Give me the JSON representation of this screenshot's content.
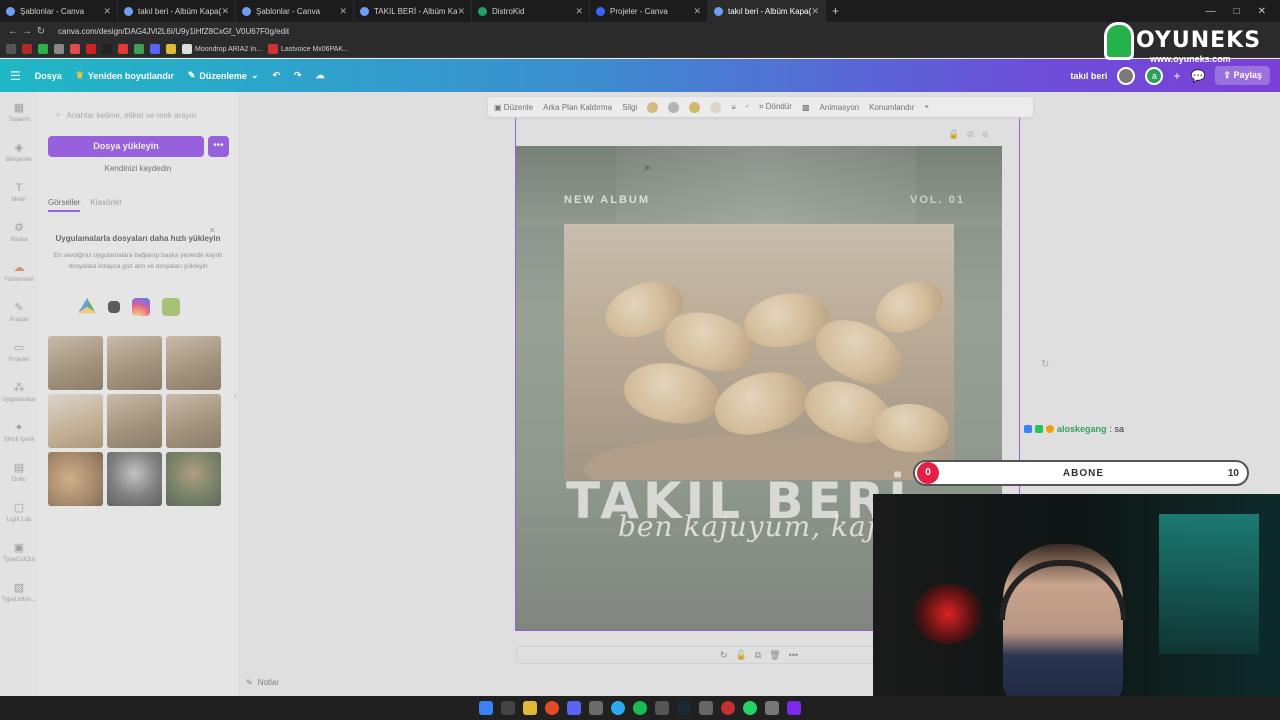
{
  "browser": {
    "tabs": [
      {
        "title": "Şablonlar - Canva",
        "active": false
      },
      {
        "title": "takıl beri - Albüm Kapağı",
        "active": false
      },
      {
        "title": "Şablonlar - Canva",
        "active": false
      },
      {
        "title": "TAKIL BERİ - Albüm Kapağı",
        "active": false
      },
      {
        "title": "DistroKid",
        "active": false
      },
      {
        "title": "Projeler - Canva",
        "active": false
      },
      {
        "title": "takıl beri - Albüm Kapağı",
        "active": true
      }
    ],
    "url": "canva.com/design/DAG4JVi2L6I/U9y1iHfZ8CxGf_V0U67F0g/edit",
    "bookmarks": [
      "Moondrop ARIA2 In...",
      "Lastvoice Mx06PAK..."
    ]
  },
  "canva_top": {
    "file": "Dosya",
    "resize": "Yeniden boyutlandır",
    "edit": "Düzenleme",
    "project_name": "takıl beri",
    "avatar_letter": "a",
    "share": "Paylaş"
  },
  "rail": [
    {
      "icon": "design-icon",
      "label": "Tasarım"
    },
    {
      "icon": "elements-icon",
      "label": "Bileşenler"
    },
    {
      "icon": "text-icon",
      "label": "Metin"
    },
    {
      "icon": "brand-icon",
      "label": "Marka"
    },
    {
      "icon": "uploads-icon",
      "label": "Yüklemeler"
    },
    {
      "icon": "tools-icon",
      "label": "Araçlar"
    },
    {
      "icon": "projects-icon",
      "label": "Projeler"
    },
    {
      "icon": "apps-icon",
      "label": "Uygulamalar"
    },
    {
      "icon": "magic-icon",
      "label": "Sihirli Içerik"
    },
    {
      "icon": "texture-icon",
      "label": "Doku"
    },
    {
      "icon": "lightlab-icon",
      "label": "Light Lab"
    },
    {
      "icon": "typecut-icon",
      "label": "TypeCutOut"
    },
    {
      "icon": "typeletter-icon",
      "label": "TypeLetteri..."
    }
  ],
  "panel": {
    "search_placeholder": "Anahtar kelime, etiket ve renk arayın",
    "upload_button": "Dosya yükleyin",
    "more": "•••",
    "record": "Kendinizi kaydedin",
    "tabs": [
      "Görseller",
      "Klasörler"
    ],
    "promo_title": "Uygulamalarla dosyaları daha hızlı yükleyin",
    "promo_desc": "En sevdiğiniz uygulamalara bağlanıp başka yerlerde kayıtlı dosyalara kolayca göz atın ve dosyaları yükleyin",
    "notes": "Notlar"
  },
  "toolbar": {
    "edit": "Düzenle",
    "bg_remove": "Arka Plan Kaldırma",
    "erase": "Silgi",
    "crop": "Döndür",
    "animate": "Animasyon",
    "position": "Konumlandır",
    "swatches": [
      "#d9b15c",
      "#a8a8a8",
      "#d4b13a",
      "#e8dfc2"
    ]
  },
  "design": {
    "new_album": "NEW ALBUM",
    "vol": "VOL. 01",
    "title": "TAKIL BERİ",
    "subtitle": "ben kajuyum, kaju b"
  },
  "overlay": {
    "brand": "OYUNEKS",
    "site": "www.oyuneks.com",
    "chat_user": "aloskegang",
    "chat_msg": ": sa",
    "sub_current": "0",
    "sub_label": "ABONE",
    "sub_goal": "10",
    "sub_progress": 0
  }
}
